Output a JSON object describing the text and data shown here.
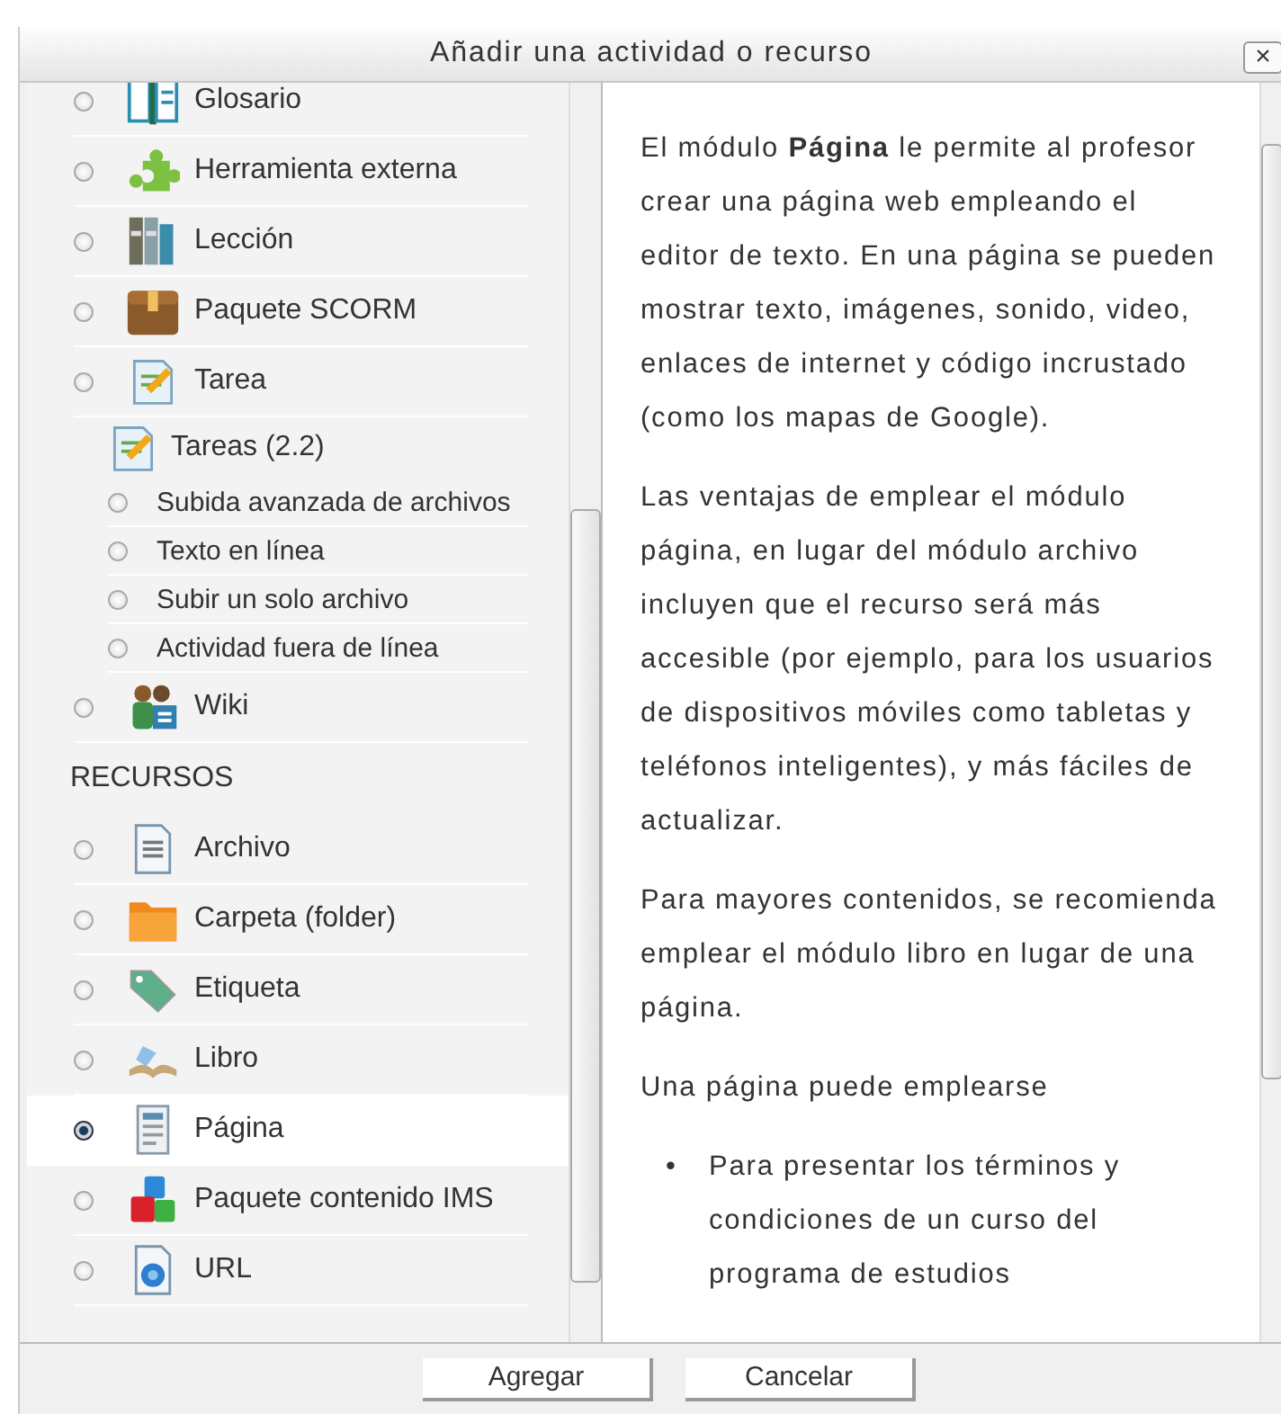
{
  "dialog": {
    "title": "Añadir una actividad o recurso",
    "close": "×"
  },
  "items": [
    {
      "kind": "option",
      "label": "Glosario",
      "selected": false
    },
    {
      "kind": "option",
      "label": "Herramienta externa",
      "selected": false
    },
    {
      "kind": "option",
      "label": "Lección",
      "selected": false
    },
    {
      "kind": "option",
      "label": "Paquete SCORM",
      "selected": false
    },
    {
      "kind": "option",
      "label": "Tarea",
      "selected": false
    },
    {
      "kind": "group",
      "label": "Tareas (2.2)"
    },
    {
      "kind": "suboption",
      "label": "Subida avanzada de archivos",
      "selected": false
    },
    {
      "kind": "suboption",
      "label": "Texto en línea",
      "selected": false
    },
    {
      "kind": "suboption",
      "label": "Subir un solo archivo",
      "selected": false
    },
    {
      "kind": "suboption",
      "label": "Actividad fuera de línea",
      "selected": false
    },
    {
      "kind": "option",
      "label": "Wiki",
      "selected": false
    },
    {
      "kind": "heading",
      "label": "RECURSOS"
    },
    {
      "kind": "option",
      "label": "Archivo",
      "selected": false
    },
    {
      "kind": "option",
      "label": "Carpeta (folder)",
      "selected": false
    },
    {
      "kind": "option",
      "label": "Etiqueta",
      "selected": false
    },
    {
      "kind": "option",
      "label": "Libro",
      "selected": false
    },
    {
      "kind": "option",
      "label": "Página",
      "selected": true
    },
    {
      "kind": "option",
      "label": "Paquete contenido IMS",
      "selected": false
    },
    {
      "kind": "option",
      "label": "URL",
      "selected": false
    }
  ],
  "help": {
    "paragraphs": [
      "El módulo **Página** le permite al profesor crear una página web empleando el editor de texto. En una página se pueden mostrar texto, imágenes, sonido, video, enlaces de internet y código incrustado (como los mapas de Google).",
      "Las ventajas de emplear el módulo página, en lugar del módulo archivo incluyen que el recurso será más accesible (por ejemplo, para los usuarios de dispositivos móviles como tabletas y teléfonos inteligentes), y más fáciles de actualizar.",
      "Para mayores contenidos, se recomienda emplear el módulo libro en lugar de una página.",
      "Una página puede emplearse"
    ],
    "bullets": [
      {
        "marker": "•",
        "text": "Para presentar los términos y condiciones de un curso del programa de estudios"
      }
    ]
  },
  "buttons": [
    "Agregar",
    "Cancelar"
  ]
}
